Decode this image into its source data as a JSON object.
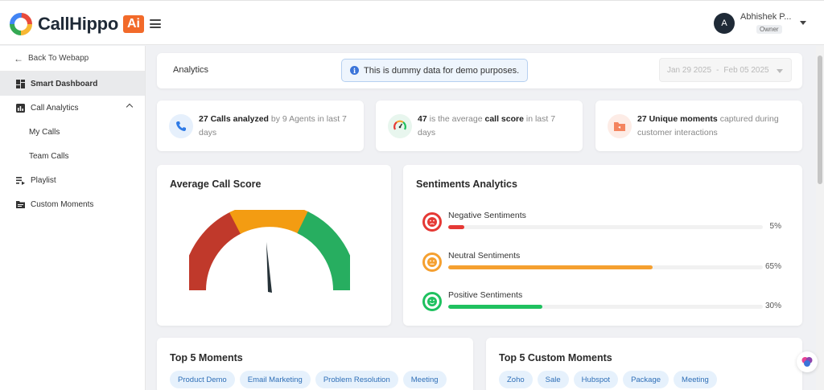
{
  "header": {
    "brand_name": "CallHippo",
    "brand_badge": "Ai",
    "user": {
      "initial": "A",
      "name": "Abhishek P...",
      "role": "Owner"
    }
  },
  "sidebar": {
    "back_label": "Back To Webapp",
    "items": [
      {
        "label": "Smart Dashboard",
        "icon": "dashboard-icon",
        "active": true
      },
      {
        "label": "Call Analytics",
        "icon": "bar-chart-icon",
        "expanded": true
      },
      {
        "label": "My Calls",
        "sub": true
      },
      {
        "label": "Team Calls",
        "sub": true
      },
      {
        "label": "Playlist",
        "icon": "playlist-icon"
      },
      {
        "label": "Custom Moments",
        "icon": "folder-icon"
      }
    ]
  },
  "analytics": {
    "title": "Analytics",
    "demo_note": "This is dummy data for demo purposes.",
    "date_from": "Jan 29 2025",
    "date_sep": "-",
    "date_to": "Feb 05 2025"
  },
  "stats": [
    {
      "strong": "27 Calls analyzed",
      "rest": " by 9 Agents in last 7 days",
      "icon": "phone-icon",
      "color": "#2f7be6"
    },
    {
      "strong_a": "47",
      "mid": " is the average ",
      "strong_b": "call score",
      "rest": " in last 7 days",
      "icon": "gauge-icon"
    },
    {
      "strong": "27 Unique moments",
      "rest": " captured during customer interactions",
      "icon": "folder-icon",
      "color": "#f4845f"
    }
  ],
  "score": {
    "title": "Average Call Score",
    "value": "47",
    "segments": [
      "#c0392b",
      "#f39c12",
      "#27ae60"
    ]
  },
  "sentiments": {
    "title": "Sentiments Analytics",
    "items": [
      {
        "label": "Negative Sentiments",
        "pct": "5%",
        "value": 5,
        "color": "#e53935"
      },
      {
        "label": "Neutral Sentiments",
        "pct": "65%",
        "value": 65,
        "color": "#f5a030"
      },
      {
        "label": "Positive Sentiments",
        "pct": "30%",
        "value": 30,
        "color": "#1fc15f"
      }
    ]
  },
  "moments": {
    "title": "Top 5 Moments",
    "chips": [
      "Product Demo",
      "Email Marketing",
      "Problem Resolution",
      "Meeting"
    ]
  },
  "custom_moments": {
    "title": "Top 5 Custom Moments",
    "chips": [
      "Zoho",
      "Sale",
      "Hubspot",
      "Package",
      "Meeting"
    ]
  }
}
